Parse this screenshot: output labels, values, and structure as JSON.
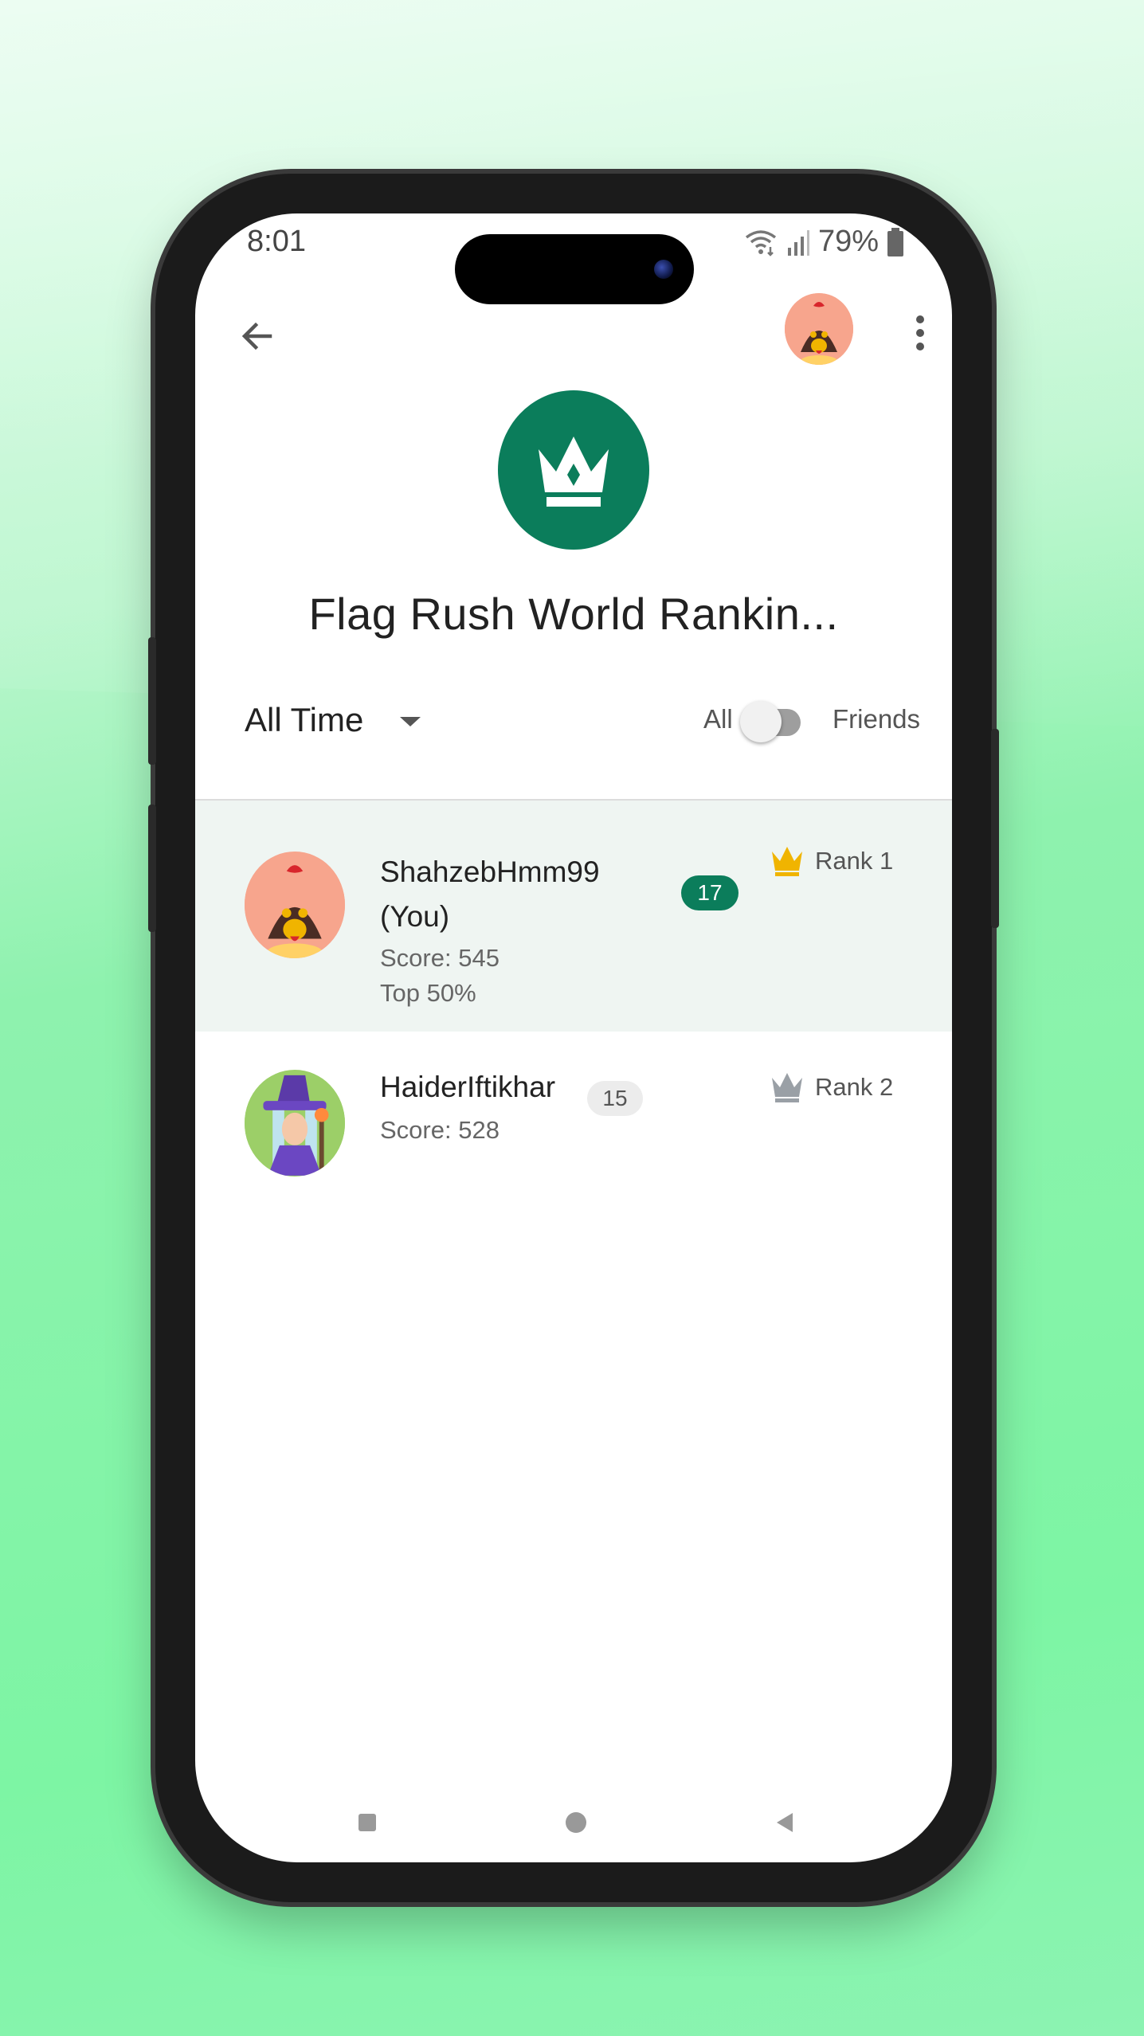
{
  "status_bar": {
    "time": "8:01",
    "battery": "79%"
  },
  "header": {
    "back_icon": "arrow-left-icon",
    "menu_icon": "more-vert-icon"
  },
  "title": "Flag Rush World Rankin...",
  "filter": {
    "time_range": "All Time",
    "toggle_left": "All",
    "toggle_right": "Friends",
    "friends_only": false
  },
  "entries": [
    {
      "name_line1": "ShahzebHmm99",
      "name_line2": "(You)",
      "level": "17",
      "score": "Score: 545",
      "percentile": "Top 50%",
      "rank": "Rank 1",
      "crown_color": "#f0b400",
      "avatar": "rooster-avatar"
    },
    {
      "name_line1": "HaiderIftikhar",
      "level": "15",
      "score": "Score: 528",
      "rank": "Rank 2",
      "crown_color": "#9aa0a6",
      "avatar": "wizard-avatar"
    }
  ],
  "colors": {
    "accent": "#0b7d5b",
    "highlight_row": "#eff5f2"
  }
}
